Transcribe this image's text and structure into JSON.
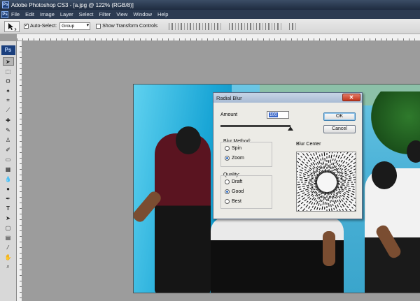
{
  "window": {
    "title": "Adobe Photoshop CS3 - [a.jpg @ 122% (RGB/8)]"
  },
  "menu": [
    "File",
    "Edit",
    "Image",
    "Layer",
    "Select",
    "Filter",
    "View",
    "Window",
    "Help"
  ],
  "options_bar": {
    "auto_select_label": "Auto-Select:",
    "auto_select_checked": true,
    "auto_select_value": "Group",
    "show_transform_label": "Show Transform Controls",
    "show_transform_checked": false
  },
  "toolbox": {
    "logo": "Ps",
    "tools": [
      "move-icon",
      "marquee-icon",
      "lasso-icon",
      "magic-wand-icon",
      "crop-icon",
      "slice-icon",
      "healing-icon",
      "brush-icon",
      "stamp-icon",
      "history-brush-icon",
      "eraser-icon",
      "gradient-icon",
      "blur-icon",
      "dodge-icon",
      "pen-icon",
      "type-icon",
      "path-select-icon",
      "shape-icon",
      "notes-icon",
      "eyedropper-icon",
      "hand-icon",
      "zoom-icon"
    ]
  },
  "dialog": {
    "title": "Radial Blur",
    "amount_label": "Amount",
    "amount_value": "100",
    "amount_fraction": 1.0,
    "ok_label": "OK",
    "cancel_label": "Cancel",
    "blur_method": {
      "label": "Blur Method:",
      "options": [
        {
          "label": "Spin",
          "selected": false
        },
        {
          "label": "Zoom",
          "selected": true
        }
      ]
    },
    "quality": {
      "label": "Quality:",
      "options": [
        {
          "label": "Draft",
          "selected": false
        },
        {
          "label": "Good",
          "selected": true
        },
        {
          "label": "Best",
          "selected": false
        }
      ]
    },
    "blur_center_label": "Blur Center"
  },
  "colors": {
    "title_bar": "#2a3a52",
    "dialog_bg": "#ecebe6",
    "selection": "#3866c8"
  }
}
